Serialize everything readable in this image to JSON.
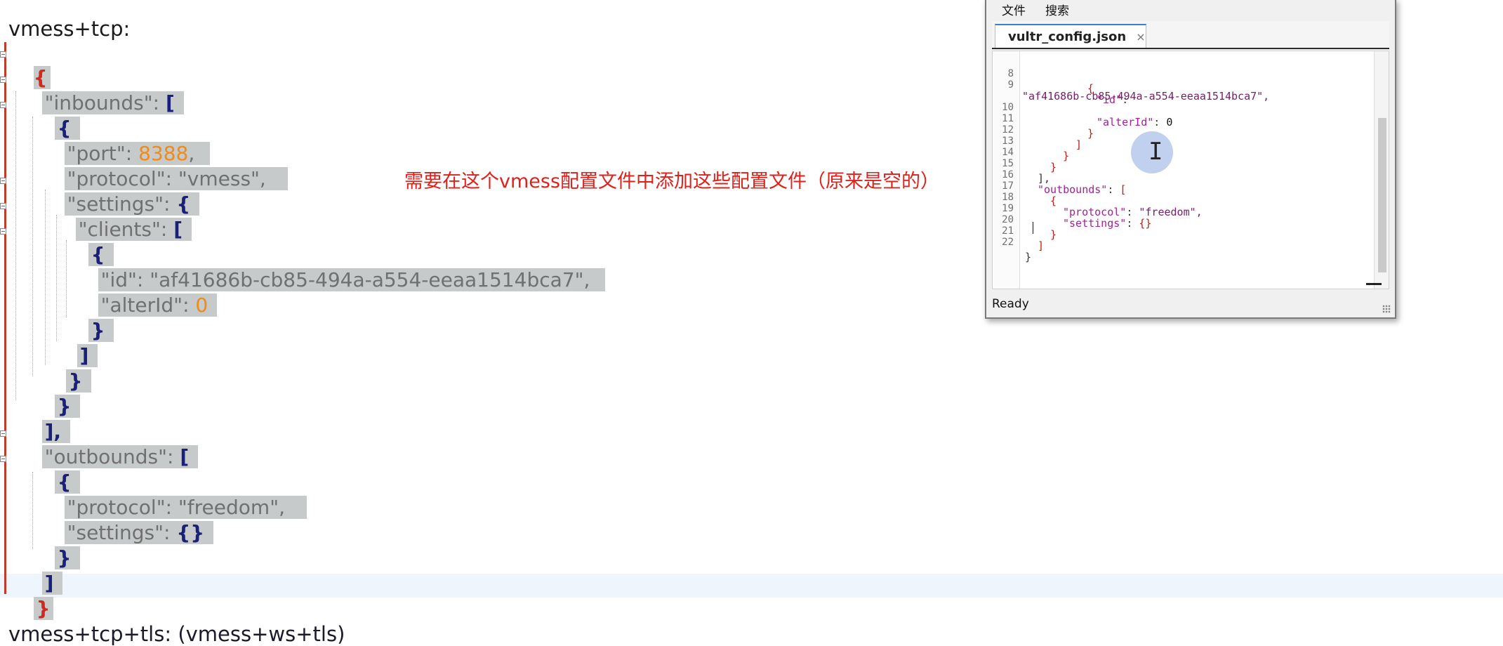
{
  "document": {
    "heading_top": "vmess+tcp:",
    "heading_bottom": "vmess+tcp+tls: (vmess+ws+tls)",
    "annotation": "需要在这个vmess配置文件中添加这些配置文件（原来是空的）",
    "code": {
      "l1_open": "{",
      "l2_key": "\"inbounds\"",
      "l2_colon": ": ",
      "l2_br": "[",
      "l3_br": "{",
      "l4_key": "\"port\"",
      "l4_colon": ": ",
      "l4_val": "8388",
      "l4_comma": ",",
      "l5_key": "\"protocol\"",
      "l5_rest": ": \"vmess\",",
      "l6_key": "\"settings\"",
      "l6_colon": ": ",
      "l6_br": "{",
      "l7_key": "\"clients\"",
      "l7_colon": ": ",
      "l7_br": "[",
      "l8_br": "{",
      "l9_key": "\"id\"",
      "l9_rest": ": \"af41686b-cb85-494a-a554-eeaa1514bca7\",",
      "l10_key": "\"alterId\"",
      "l10_colon": ": ",
      "l10_val": "0",
      "l11_br": "}",
      "l12_br": "]",
      "l13_br": "}",
      "l14_br": "}",
      "l15_br": "],",
      "l16_key": "\"outbounds\"",
      "l16_colon": ": ",
      "l16_br": "[",
      "l17_br": "{",
      "l18_key": "\"protocol\"",
      "l18_rest": ": \"freedom\",",
      "l19_key": "\"settings\"",
      "l19_colon": ": ",
      "l19_br": "{}",
      "l20_br": "}",
      "l21_br": "]",
      "l22_close": "}"
    }
  },
  "editor": {
    "menu": [
      "文件",
      "搜索"
    ],
    "tab_label": "vultr_config.json",
    "tab_close": "×",
    "status": "Ready",
    "lines": [
      {
        "n": "8",
        "t": "{"
      },
      {
        "n": "9",
        "key": "\"id\"",
        "colon": ":"
      },
      {
        "n": "",
        "str": "\"af41686b-cb85-494a-a554-eeaa1514bca7\","
      },
      {
        "n": "10",
        "key": "\"alterId\"",
        "colon": ": ",
        "num": "0"
      },
      {
        "n": "11",
        "t": "}"
      },
      {
        "n": "12",
        "t": "]"
      },
      {
        "n": "13",
        "t": "}"
      },
      {
        "n": "14",
        "t": "}"
      },
      {
        "n": "15",
        "t": "],"
      },
      {
        "n": "16",
        "key": "\"outbounds\"",
        "colon": ": ",
        "t2": "["
      },
      {
        "n": "17",
        "t": "{"
      },
      {
        "n": "18",
        "key": "\"protocol\"",
        "colon": ": ",
        "str2": "\"freedom\","
      },
      {
        "n": "19",
        "key": "\"settings\"",
        "colon": ": ",
        "t2": "{}"
      },
      {
        "n": "20",
        "t": "}"
      },
      {
        "n": "21",
        "t": "]"
      },
      {
        "n": "22",
        "t": "}"
      }
    ]
  }
}
